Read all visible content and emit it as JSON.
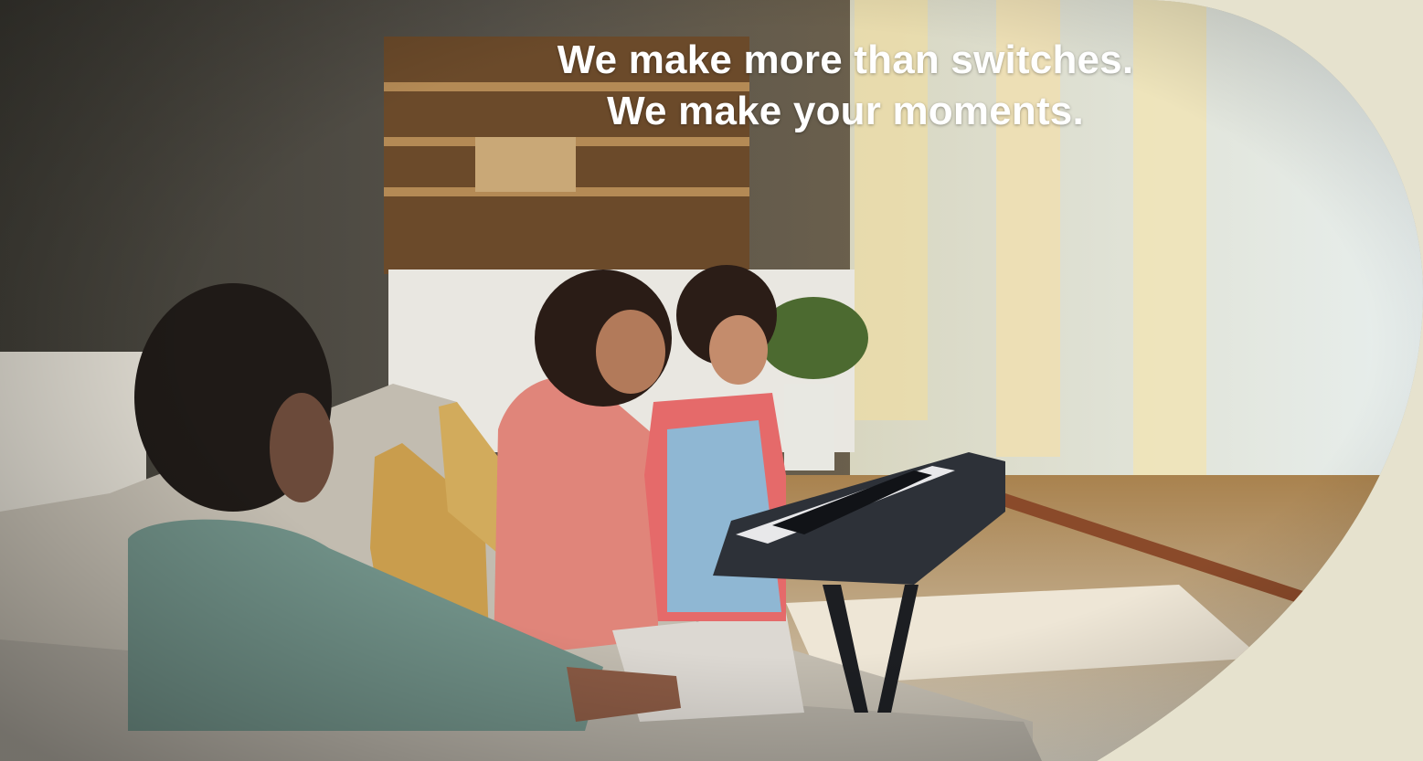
{
  "banner": {
    "headline_line1": "We make more than switches.",
    "headline_line2": "We make your moments.",
    "colors": {
      "frame_background": "#e6e2ce",
      "headline_text": "#ffffff",
      "cardigan": "#e0857a",
      "wall": "#4d4a40",
      "curtain": "#eadcae",
      "window_light": "#dfe6e3"
    },
    "scene_description_icons": [
      "family-photo",
      "keyboard-instrument-icon",
      "sofa-icon",
      "plant-icon"
    ]
  }
}
